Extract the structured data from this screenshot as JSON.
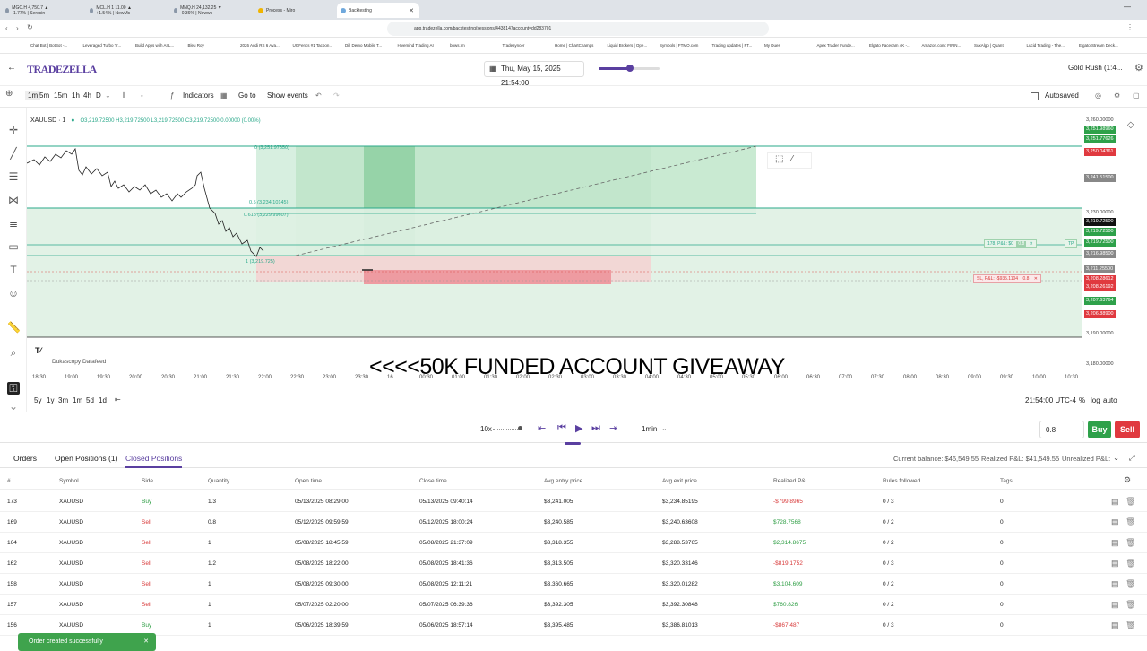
{
  "browser": {
    "tabs": [
      "MGC.H 4,750.7 ▲ -1.77% | Seresin",
      "MCL.H 1 11.00 ▲ +1.54% | NewMs",
      "MNQ.H 24,132.25 ▼ -0.36% | Newws",
      "Process - Miro",
      "Backtesting"
    ],
    "url": "app.tradezella.com/backtesting/sessions/4438147account=dd283701",
    "bookmarks": [
      "Chat Bot | BotBot -...",
      "Leveraged Turbo Tr...",
      "Build Apps with AI L...",
      "Bleu Roy",
      "2026 Audi RS 6 Ava...",
      "UGFencs #1 Tacbon...",
      "Dill Demo Mobile T...",
      "Hivemind Trading AI",
      "bnws.fm",
      "Tradesyncer",
      "Home | ChartChamps",
      "Liquid Brokers | Ope...",
      "Symbols | FTMO.com",
      "Trading updates | FT...",
      "My Dues",
      "Apex Trader Funde...",
      "Elgato Facecam 4K -...",
      "Amazon.com: FIFIN...",
      "SuxAlgo | Quant",
      "Lucid Trading - The...",
      "Elgato Stream Deck..."
    ]
  },
  "header": {
    "logo": "TRADEZELLA",
    "datetime": "Thu, May 15, 2025 21:54:00",
    "playbook": "Gold Rush (1:4..."
  },
  "toolbar": {
    "timeframes": [
      "1m",
      "5m",
      "15m",
      "1h",
      "4h",
      "D"
    ],
    "indicators": "Indicators",
    "goto": "Go to",
    "show_events": "Show events",
    "autosaved": "Autosaved"
  },
  "chart": {
    "symbol": "XAUUSD · 1",
    "ohlc": "O3,219.72500 H3,219.72500 L3,219.72500 C3,219.72500 0.00000 (0.00%)",
    "fib0": "0 (3,251.97850)",
    "fib05": "0.5 (3,234.10145)",
    "fib0618": "0.618 (3,229.99607)",
    "fib1": "1 (3,219.725)",
    "datafeed": "Dukascopy Datafeed",
    "overlay": "<<<<50K FUNDED ACCOUNT GIVEAWAY",
    "tp_label": "178, P&L: $0",
    "tp_qty": "0.8",
    "sl_label": "SL, P&L: -$935.1104",
    "sl_qty": "0.8",
    "tp_tag": "TP",
    "price_ticks": [
      {
        "label": "3,260.00000",
        "tone": "plain"
      },
      {
        "label": "3,251.98960",
        "tone": "green"
      },
      {
        "label": "3,251.77626",
        "tone": "green"
      },
      {
        "label": "3,250.04361",
        "tone": "red"
      },
      {
        "label": "3,241.51500",
        "tone": "gray"
      },
      {
        "label": "3,230.00000",
        "tone": "plain"
      },
      {
        "label": "3,219.72500",
        "tone": "dark"
      },
      {
        "label": "3,219.72500",
        "tone": "green"
      },
      {
        "label": "3,219.72500",
        "tone": "green"
      },
      {
        "label": "3,216.98500",
        "tone": "gray"
      },
      {
        "label": "3,211.25500",
        "tone": "gray"
      },
      {
        "label": "3,208.28612",
        "tone": "red"
      },
      {
        "label": "3,208.26192",
        "tone": "red"
      },
      {
        "label": "3,207.63764",
        "tone": "green"
      },
      {
        "label": "3,206.88900",
        "tone": "red"
      },
      {
        "label": "3,190.00000",
        "tone": "plain"
      },
      {
        "label": "3,180.00000",
        "tone": "plain"
      }
    ],
    "time_ticks": [
      "18:30",
      "19:00",
      "19:30",
      "20:00",
      "20:30",
      "21:00",
      "21:30",
      "22:00",
      "22:30",
      "23:00",
      "23:30",
      "16",
      "00:30",
      "01:00",
      "01:30",
      "02:00",
      "02:30",
      "03:00",
      "03:30",
      "04:00",
      "04:30",
      "05:00",
      "05:30",
      "06:00",
      "06:30",
      "07:00",
      "07:30",
      "08:00",
      "08:30",
      "09:00",
      "09:30",
      "10:00",
      "10:30"
    ],
    "ranges": [
      "5y",
      "1y",
      "3m",
      "1m",
      "5d",
      "1d"
    ],
    "clock": "21:54:00 UTC-4",
    "pct": "%",
    "log": "log",
    "auto": "auto"
  },
  "replay": {
    "speed": "10x",
    "interval": "1min",
    "qty": "0.8",
    "buy": "Buy",
    "sell": "Sell"
  },
  "positions": {
    "tabs": [
      "Orders",
      "Open Positions (1)",
      "Closed Positions"
    ],
    "balance": "Current balance: $46,549.55",
    "realized": "Realized P&L: $41,549.55",
    "unrealized": "Unrealized P&L:",
    "columns": [
      "#",
      "Symbol",
      "Side",
      "Quantity",
      "Open time",
      "Close time",
      "Avg entry price",
      "Avg exit price",
      "Realized P&L",
      "Rules followed",
      "Tags"
    ],
    "rows": [
      {
        "id": "173",
        "symbol": "XAUUSD",
        "side": "Buy",
        "qty": "1.3",
        "open": "05/13/2025 08:29:00",
        "close": "05/13/2025 09:40:14",
        "entry": "$3,241.005",
        "exit": "$3,234.85195",
        "pnl": "-$799.8965",
        "rules": "0 / 3",
        "tags": "0"
      },
      {
        "id": "169",
        "symbol": "XAUUSD",
        "side": "Sell",
        "qty": "0.8",
        "open": "05/12/2025 09:59:59",
        "close": "05/12/2025 18:00:24",
        "entry": "$3,240.585",
        "exit": "$3,240.63608",
        "pnl": "$728.7568",
        "rules": "0 / 2",
        "tags": "0"
      },
      {
        "id": "164",
        "symbol": "XAUUSD",
        "side": "Sell",
        "qty": "1",
        "open": "05/08/2025 18:45:59",
        "close": "05/08/2025 21:37:09",
        "entry": "$3,318.355",
        "exit": "$3,288.53765",
        "pnl": "$2,314.8675",
        "rules": "0 / 2",
        "tags": "0"
      },
      {
        "id": "162",
        "symbol": "XAUUSD",
        "side": "Sell",
        "qty": "1.2",
        "open": "05/08/2025 18:22:00",
        "close": "05/08/2025 18:41:36",
        "entry": "$3,313.505",
        "exit": "$3,320.33146",
        "pnl": "-$819.1752",
        "rules": "0 / 3",
        "tags": "0"
      },
      {
        "id": "158",
        "symbol": "XAUUSD",
        "side": "Sell",
        "qty": "1",
        "open": "05/08/2025 09:30:00",
        "close": "05/08/2025 12:11:21",
        "entry": "$3,360.665",
        "exit": "$3,320.01282",
        "pnl": "$3,104.609",
        "rules": "0 / 2",
        "tags": "0"
      },
      {
        "id": "157",
        "symbol": "XAUUSD",
        "side": "Sell",
        "qty": "1",
        "open": "05/07/2025 02:20:00",
        "close": "05/07/2025 06:39:36",
        "entry": "$3,392.305",
        "exit": "$3,392.30848",
        "pnl": "$760.826",
        "rules": "0 / 2",
        "tags": "0"
      },
      {
        "id": "156",
        "symbol": "XAUUSD",
        "side": "Buy",
        "qty": "1",
        "open": "05/06/2025 18:39:59",
        "close": "05/06/2025 18:57:14",
        "entry": "$3,395.485",
        "exit": "$3,386.81013",
        "pnl": "-$867.487",
        "rules": "0 / 3",
        "tags": "0"
      }
    ]
  },
  "toast": "Order created successfully"
}
